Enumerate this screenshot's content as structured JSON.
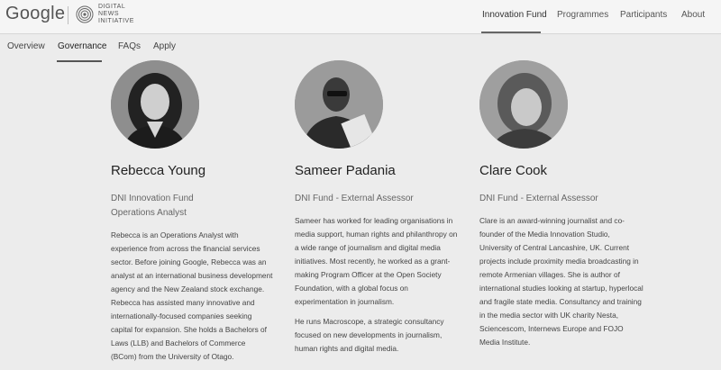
{
  "header": {
    "brand": "Google",
    "sub_brand_lines": [
      "DIGITAL",
      "NEWS",
      "INITIATIVE"
    ],
    "nav": [
      {
        "label": "Innovation Fund",
        "active": true
      },
      {
        "label": "Programmes",
        "active": false
      },
      {
        "label": "Participants",
        "active": false
      },
      {
        "label": "About",
        "active": false
      }
    ]
  },
  "subnav": {
    "items": [
      {
        "label": "Overview",
        "active": false
      },
      {
        "label": "Governance",
        "active": true
      },
      {
        "label": "FAQs",
        "active": false
      },
      {
        "label": "Apply",
        "active": false
      }
    ]
  },
  "people": [
    {
      "name": "Rebecca Young",
      "role_lines": [
        "DNI Innovation Fund",
        "Operations Analyst"
      ],
      "bio": [
        "Rebecca is an Operations Analyst with experience from across the financial services sector. Before joining Google, Rebecca was an analyst at an international business development agency and the New Zealand stock exchange. Rebecca has assisted many innovative and internationally-focused companies seeking capital for expansion. She holds a Bachelors of Laws (LLB) and Bachelors of Commerce (BCom) from the University of Otago."
      ]
    },
    {
      "name": "Sameer Padania",
      "role_lines": [
        "DNI Fund - External Assessor"
      ],
      "bio": [
        "Sameer has worked for leading organisations in media support, human rights and philanthropy on a wide range of journalism and digital media initiatives. Most recently, he worked as a grant-making Program Officer at the Open Society Foundation, with a global focus on experimentation in journalism.",
        "He runs Macroscope, a strategic consultancy focused on new developments in journalism, human rights and digital media."
      ]
    },
    {
      "name": "Clare Cook",
      "role_lines": [
        "DNI Fund - External Assessor"
      ],
      "bio": [
        "Clare is an award-winning journalist and co-founder of the Media Innovation Studio, University of Central Lancashire, UK. Current projects include proximity media broadcasting in remote Armenian villages. She is author of international studies looking at startup, hyperlocal and fragile state media. Consultancy and training in the media sector with UK charity Nesta, Sciencescom, Internews Europe and FOJO Media Institute."
      ]
    }
  ]
}
